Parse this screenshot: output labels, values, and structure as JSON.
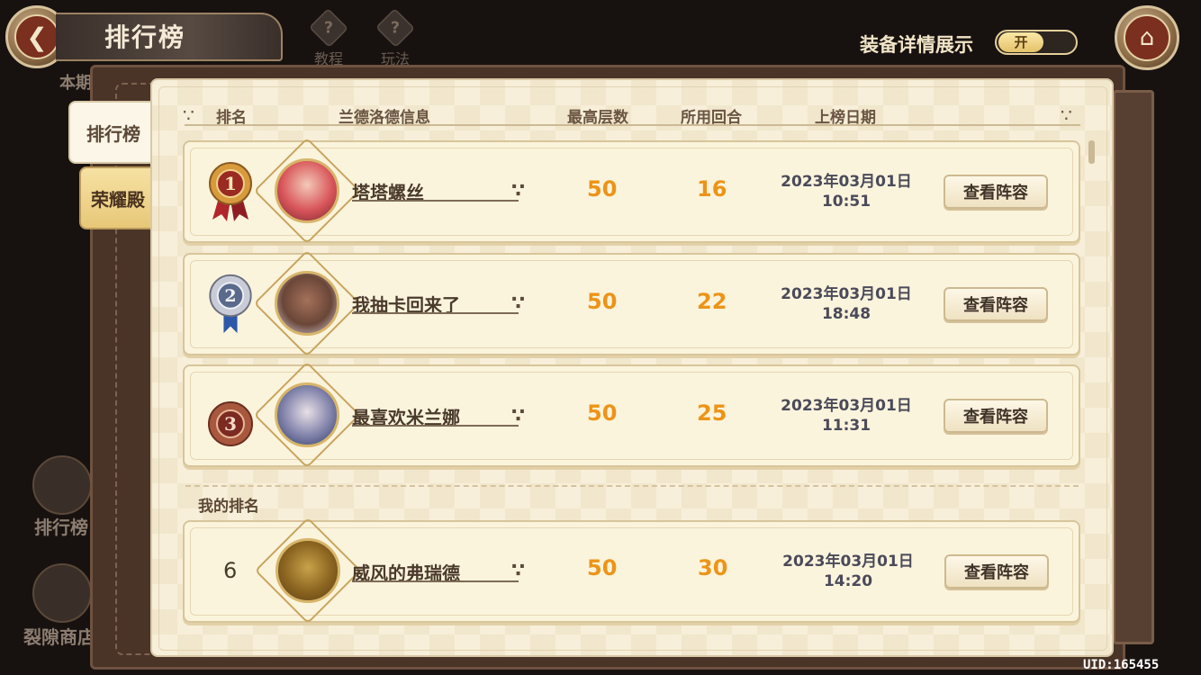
{
  "header": {
    "title": "排行榜",
    "icons": [
      {
        "label": "教程",
        "icon": "book-question-icon"
      },
      {
        "label": "玩法",
        "icon": "question-icon"
      }
    ],
    "equip_detail_label": "装备详情展示",
    "equip_toggle": "开"
  },
  "background": {
    "partial_label_top": "本期",
    "side_items": [
      {
        "label": "排行榜",
        "icon": "ranking-board-icon"
      },
      {
        "label": "裂隙商店",
        "icon": "rift-shop-icon"
      }
    ]
  },
  "tabs": [
    {
      "label": "排行榜",
      "active": true
    },
    {
      "label": "荣耀殿",
      "active": false
    }
  ],
  "columns": {
    "rank": "排名",
    "info": "兰德洛德信息",
    "max_floor": "最高层数",
    "rounds": "所用回合",
    "date": "上榜日期"
  },
  "rows": [
    {
      "rank": "1",
      "medal": "gold-medal-icon",
      "name": "塔塔螺丝",
      "max_floor": "50",
      "rounds": "16",
      "date": "2023年03月01日",
      "time": "10:51",
      "button": "查看阵容"
    },
    {
      "rank": "2",
      "medal": "silver-medal-icon",
      "name": "我抽卡回来了",
      "max_floor": "50",
      "rounds": "22",
      "date": "2023年03月01日",
      "time": "18:48",
      "button": "查看阵容"
    },
    {
      "rank": "3",
      "medal": "bronze-medal-icon",
      "name": "最喜欢米兰娜",
      "max_floor": "50",
      "rounds": "25",
      "date": "2023年03月01日",
      "time": "11:31",
      "button": "查看阵容"
    }
  ],
  "my_rank": {
    "label": "我的排名",
    "rank": "6",
    "name": "威风的弗瑞德",
    "max_floor": "50",
    "rounds": "30",
    "date": "2023年03月01日",
    "time": "14:20",
    "button": "查看阵容"
  },
  "uid": "UID:165455",
  "colors": {
    "value_orange": "#ec9419",
    "paper": "#f7efd9",
    "frame": "#4a3427"
  }
}
